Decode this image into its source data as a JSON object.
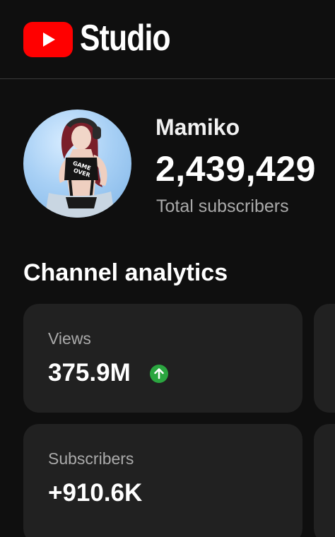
{
  "header": {
    "logo_icon": "youtube-play-icon",
    "app_name": "Studio",
    "brand_color": "#ff0000"
  },
  "channel": {
    "name": "Mamiko",
    "subscriber_count": "2,439,429",
    "subscriber_label": "Total subscribers",
    "avatar_text": "GAME OVER"
  },
  "analytics": {
    "title": "Channel analytics",
    "cards": [
      {
        "label": "Views",
        "value": "375.9M",
        "trend_icon": "arrow-up-circle-icon",
        "trend_color": "#2ba640"
      },
      {
        "label": "Subscribers",
        "value": "+910.6K"
      }
    ]
  }
}
